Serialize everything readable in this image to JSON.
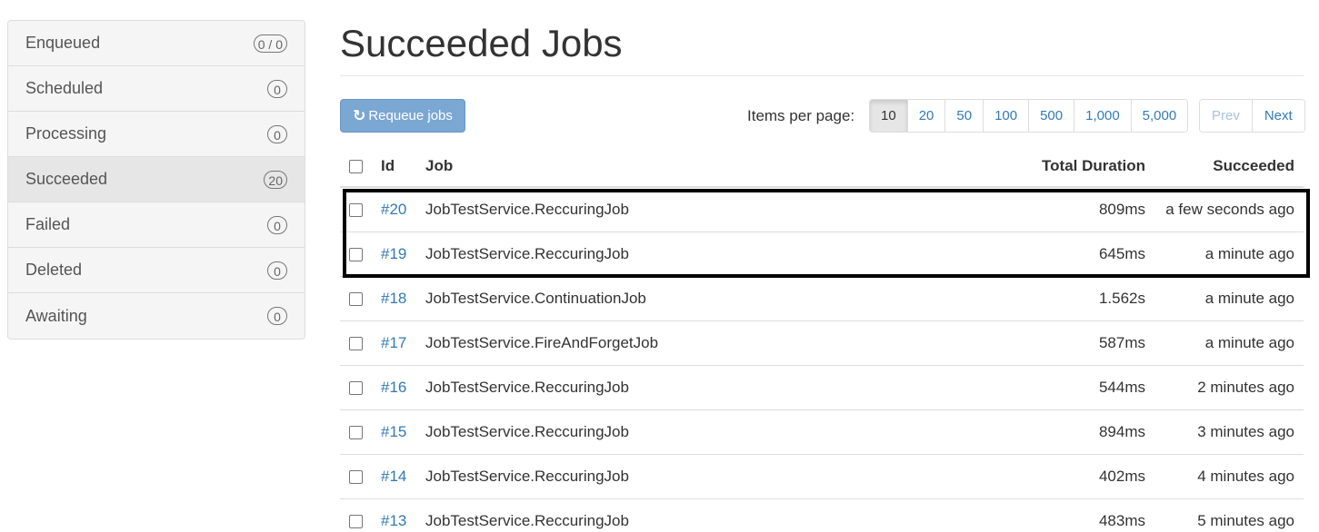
{
  "sidebar": {
    "items": [
      {
        "label": "Enqueued",
        "badge": "0 / 0",
        "active": false
      },
      {
        "label": "Scheduled",
        "badge": "0",
        "active": false
      },
      {
        "label": "Processing",
        "badge": "0",
        "active": false
      },
      {
        "label": "Succeeded",
        "badge": "20",
        "active": true
      },
      {
        "label": "Failed",
        "badge": "0",
        "active": false
      },
      {
        "label": "Deleted",
        "badge": "0",
        "active": false
      },
      {
        "label": "Awaiting",
        "badge": "0",
        "active": false
      }
    ]
  },
  "main": {
    "title": "Succeeded Jobs",
    "requeue_label": "Requeue jobs",
    "requeue_icon": "refresh-icon",
    "items_per_page_label": "Items per page:",
    "page_sizes": [
      "10",
      "20",
      "50",
      "100",
      "500",
      "1,000",
      "5,000"
    ],
    "selected_page_size": "10",
    "pager": {
      "prev": "Prev",
      "next": "Next",
      "prev_disabled": true
    }
  },
  "table": {
    "headers": {
      "id": "Id",
      "job": "Job",
      "duration": "Total Duration",
      "succeeded": "Succeeded"
    },
    "rows": [
      {
        "id": "#20",
        "job": "JobTestService.ReccuringJob",
        "duration": "809ms",
        "succeeded": "a few seconds ago"
      },
      {
        "id": "#19",
        "job": "JobTestService.ReccuringJob",
        "duration": "645ms",
        "succeeded": "a minute ago"
      },
      {
        "id": "#18",
        "job": "JobTestService.ContinuationJob",
        "duration": "1.562s",
        "succeeded": "a minute ago"
      },
      {
        "id": "#17",
        "job": "JobTestService.FireAndForgetJob",
        "duration": "587ms",
        "succeeded": "a minute ago"
      },
      {
        "id": "#16",
        "job": "JobTestService.ReccuringJob",
        "duration": "544ms",
        "succeeded": "2 minutes ago"
      },
      {
        "id": "#15",
        "job": "JobTestService.ReccuringJob",
        "duration": "894ms",
        "succeeded": "3 minutes ago"
      },
      {
        "id": "#14",
        "job": "JobTestService.ReccuringJob",
        "duration": "402ms",
        "succeeded": "4 minutes ago"
      },
      {
        "id": "#13",
        "job": "JobTestService.ReccuringJob",
        "duration": "483ms",
        "succeeded": "5 minutes ago"
      }
    ]
  },
  "colors": {
    "link": "#337ab7",
    "requeue_button": "#7ba7d3",
    "active_sidebar": "#e6e6e6",
    "highlight_border": "#000000"
  }
}
